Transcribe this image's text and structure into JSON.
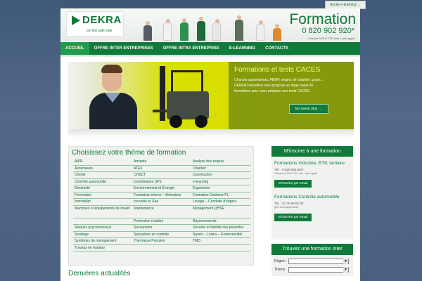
{
  "top_link": "Accès e-learning →",
  "header": {
    "logo_text": "DEKRA",
    "logo_tagline": "On the safe side.",
    "formation_title": "Formation",
    "phone": "0 820 902 920*",
    "phone_note": "* Service 0,15 € TTC /min + prix appel"
  },
  "nav": [
    "ACCUEIL",
    "OFFRE INTER ENTREPRISES",
    "OFFRE INTRA ENTREPRISE",
    "E-LEARNING",
    "CONTACTS"
  ],
  "banner": {
    "title": "Formations et tests CACES",
    "text": "Chariots automoteurs, PEMP, engins de chantier, grues... DEKRA Formation vous propose un large panel de formations pour vous préparer aux tests CACES.",
    "button": "En savoir plus →"
  },
  "themes": {
    "title": "Choisissez votre thème de formation",
    "rows": [
      [
        "AIPR",
        "Amiante",
        "Analyse des risques"
      ],
      [
        "Ascenseurs",
        "ATEX",
        "Chantier"
      ],
      [
        "Chimie",
        "CHSCT",
        "Construction"
      ],
      [
        "Contrôle automobile",
        "Coordination SPS",
        "e-learning"
      ],
      [
        "Electricité",
        "Environnement et Énergie",
        "Ergonomie"
      ],
      [
        "Ferroviaire",
        "Formateur interne – Animateur",
        "Formation Continue PL"
      ],
      [
        "Immobilier",
        "Incendie et Gaz",
        "Levage – Conduite d'engins"
      ],
      [
        "Machines et équipements de travail",
        "Maintenance",
        "Management QHSE"
      ],
      [
        "",
        "Prévention routière",
        "Rayonnements"
      ],
      [
        "Risques psychosociaux",
        "Secourisme",
        "Sécurité et fiabilité des procédés"
      ],
      [
        "Soudage",
        "Spécialiste en contrôle",
        "Sports – Loisirs – Événementiel"
      ],
      [
        "Systèmes de management",
        "Thermique Pression",
        "TMD"
      ],
      [
        "Travaux en hauteur",
        "",
        ""
      ]
    ]
  },
  "news_title": "Dernières actualités",
  "right_panel": {
    "inscrire_title": "M'inscrire à une formation",
    "sections": [
      {
        "title": "Formations Industrie, BTP, tertiaire",
        "tel": "Tél. : 0 820 902 920*",
        "note": "*Service 0.15 € TTC / min + prix appel",
        "button": "M'inscrire par email"
      },
      {
        "title": "Formations Contrôle automobile",
        "tel": "Tél. : 01 30 69 52 00",
        "note": "(prix d'un appel local)",
        "button": "M'inscrire par email"
      }
    ],
    "search_title": "Trouvez une formation inter",
    "region_label": "Région",
    "theme_label": "Thème"
  }
}
